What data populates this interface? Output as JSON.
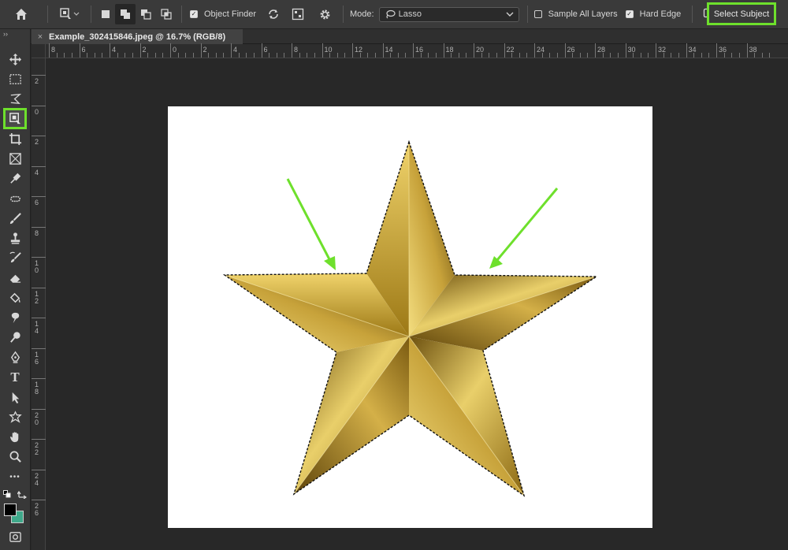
{
  "options_bar": {
    "object_finder_label": "Object Finder",
    "object_finder_checked": true,
    "mode_label": "Mode:",
    "mode_value": "Lasso",
    "sample_all_layers_label": "Sample All Layers",
    "sample_all_layers_checked": false,
    "hard_edge_label": "Hard Edge",
    "hard_edge_checked": true,
    "select_subject_label": "Select Subject"
  },
  "document_tab": {
    "close_glyph": "×",
    "title": "Example_302415846.jpeg @ 16.7% (RGB/8)"
  },
  "toolbar": {
    "collapse_glyph": "››",
    "more_glyph": "•••",
    "tools": [
      {
        "name": "move-tool",
        "icon": "move-icon"
      },
      {
        "name": "marquee-tool",
        "icon": "rect-marquee-icon"
      },
      {
        "name": "lasso-tool",
        "icon": "lasso-icon"
      },
      {
        "name": "object-selection-tool",
        "icon": "object-selection-icon",
        "active": true
      },
      {
        "name": "crop-tool",
        "icon": "crop-icon"
      },
      {
        "name": "frame-tool",
        "icon": "frame-icon"
      },
      {
        "name": "eyedropper-tool",
        "icon": "eyedropper-icon"
      },
      {
        "name": "healing-brush-tool",
        "icon": "healing-icon"
      },
      {
        "name": "brush-tool",
        "icon": "brush-icon"
      },
      {
        "name": "clone-stamp-tool",
        "icon": "stamp-icon"
      },
      {
        "name": "history-brush-tool",
        "icon": "history-brush-icon"
      },
      {
        "name": "eraser-tool",
        "icon": "eraser-icon"
      },
      {
        "name": "paint-bucket-tool",
        "icon": "bucket-icon"
      },
      {
        "name": "smudge-tool",
        "icon": "smudge-icon"
      },
      {
        "name": "dodge-tool",
        "icon": "dodge-icon"
      },
      {
        "name": "pen-tool",
        "icon": "pen-icon"
      },
      {
        "name": "type-tool",
        "icon": "type-icon"
      },
      {
        "name": "path-selection-tool",
        "icon": "arrow-icon"
      },
      {
        "name": "shape-tool",
        "icon": "shape-icon"
      },
      {
        "name": "hand-tool",
        "icon": "hand-icon"
      },
      {
        "name": "zoom-tool",
        "icon": "zoom-icon"
      }
    ],
    "type_tool_glyph": "T",
    "foreground_color": "#000000",
    "background_color": "#3fa88a"
  },
  "rulers": {
    "horizontal_labels": [
      "8",
      "6",
      "4",
      "2",
      "0",
      "2",
      "4",
      "6",
      "8",
      "10",
      "12",
      "14",
      "16",
      "18",
      "20",
      "22",
      "24",
      "26",
      "28",
      "30",
      "32",
      "34",
      "36",
      "38"
    ],
    "vertical_labels": [
      "2",
      "0",
      "2",
      "4",
      "6",
      "8",
      "10",
      "12",
      "14",
      "16",
      "18",
      "20",
      "22",
      "24",
      "26"
    ]
  },
  "annotations": {
    "highlight_color": "#6ee02c",
    "arrow_color": "#6ee02c"
  }
}
